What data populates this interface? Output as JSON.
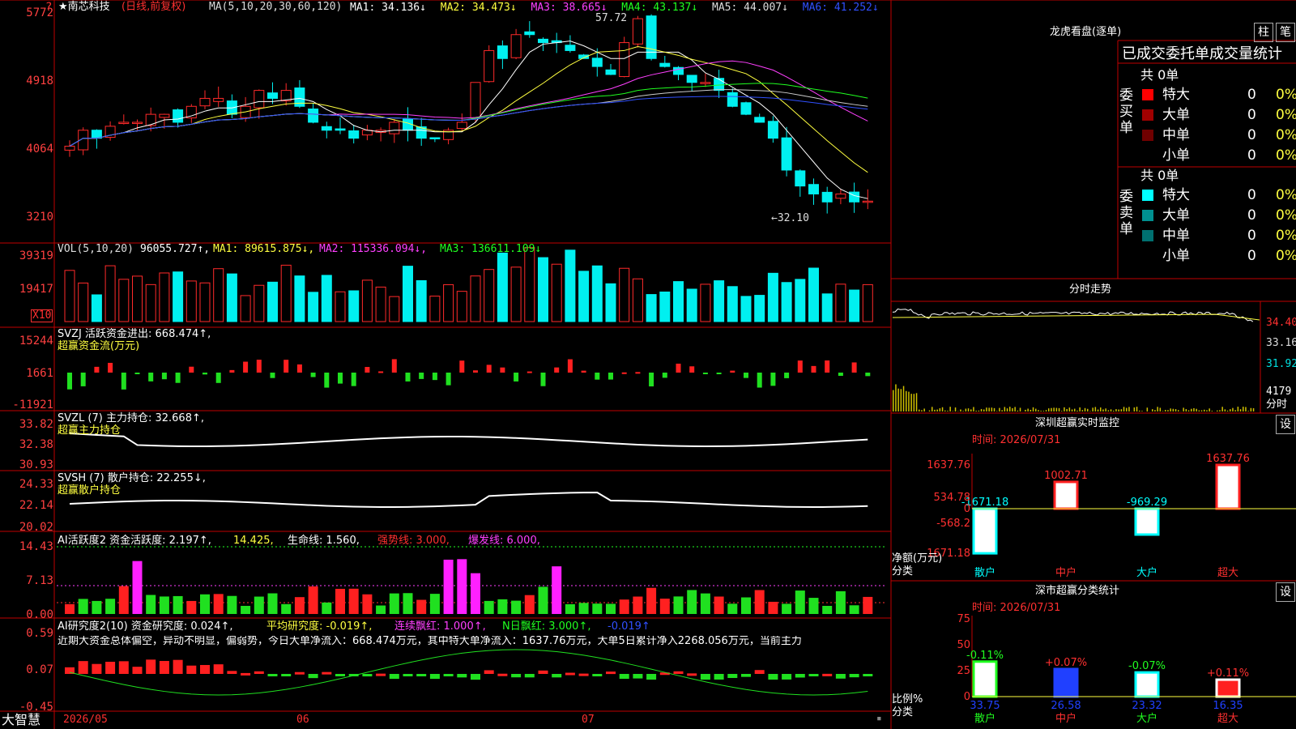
{
  "colors": {
    "up": "#ff2a2a",
    "down": "#00f0f0",
    "grid": "#c00000",
    "white": "#ffffff",
    "yellow": "#ffff40",
    "magenta": "#ff40ff",
    "green": "#20ff20",
    "blue": "#3040ff",
    "text": "#dddddd"
  },
  "main": {
    "menu_icon": "menu-icon",
    "stock": "★南芯科技",
    "mode": "(日线,前复权)",
    "ma_spec": "MA(5,10,20,30,60,120)",
    "ma": [
      {
        "label": "MA1: 34.136↓",
        "color": "#ffffff"
      },
      {
        "label": "MA2: 34.473↓",
        "color": "#ffff40"
      },
      {
        "label": "MA3: 38.665↓",
        "color": "#ff40ff"
      },
      {
        "label": "MA4: 43.137↓",
        "color": "#20ff20"
      },
      {
        "label": "MA5: 44.007↓",
        "color": "#dddddd"
      },
      {
        "label": "MA6: 41.252↓",
        "color": "#3050ff"
      }
    ],
    "axis": [
      "5772",
      "4918",
      "4064",
      "3210"
    ],
    "high_label": "57.72",
    "low_label": "←32.10"
  },
  "vol": {
    "title": "VOL(5,10,20)",
    "value": "96055.727↑,",
    "ma": [
      "MA1: 89615.875↓,",
      "MA2: 115336.094↓,",
      "MA3: 136611.109↓"
    ],
    "axis": [
      "39319",
      "19417"
    ],
    "unit": "X10"
  },
  "svzj": {
    "title": "SVZJ  活跃资金进出: 668.474↑,",
    "sub": "超赢资金流(万元)",
    "axis": [
      "15244",
      "1661",
      "-11921"
    ]
  },
  "svzl": {
    "title": "SVZL (7) 主力持仓: 32.668↑,",
    "sub": "超赢主力持仓",
    "axis": [
      "33.82",
      "32.38",
      "30.93"
    ]
  },
  "svsh": {
    "title": "SVSH (7) 散户持仓: 22.255↓,",
    "sub": "超赢散户持仓",
    "axis": [
      "24.33",
      "22.14",
      "20.02"
    ]
  },
  "ai1": {
    "title": "AI活跃度2 资金活跃度: 2.197↑,",
    "parts": [
      "14.425,",
      "生命线: 1.560,",
      "强势线: 3.000,",
      "爆发线: 6.000,"
    ],
    "axis": [
      "14.43",
      "7.13",
      "0.00"
    ]
  },
  "ai2": {
    "title": "AI研究度2(10) 资金研究度: 0.024↑,",
    "parts": [
      "平均研究度: -0.019↑,",
      "连续飘红: 1.000↑,",
      "N日飘红: 3.000↑,",
      "-0.019↑"
    ],
    "summary": "近期大资金总体偏空，异动不明显，偏弱势，今日大单净流入：668.474万元，其中特大单净流入：1637.76万元，大单5日累计净入2268.056万元，当前主力",
    "axis": [
      "0.59",
      "0.07",
      "-0.45"
    ]
  },
  "bottom": {
    "brand": "大智慧",
    "dates": [
      "2026/05",
      "06",
      "07"
    ]
  },
  "lhb": {
    "title": "龙虎看盘(逐单)",
    "btn1": "柱",
    "btn2": "笔",
    "header": "已成交委托单成交量统计",
    "buy_label": "委买单",
    "sell_label": "委卖单",
    "buy_total": "共 0单",
    "sell_total": "共 0单",
    "buy_rows": [
      {
        "name": "特大",
        "v": "0",
        "p": "0%",
        "c": "#ff0000"
      },
      {
        "name": "大单",
        "v": "0",
        "p": "0%",
        "c": "#a00000"
      },
      {
        "name": "中单",
        "v": "0",
        "p": "0%",
        "c": "#700000"
      },
      {
        "name": "小单",
        "v": "0",
        "p": "0%",
        "c": "#000000"
      }
    ],
    "sell_rows": [
      {
        "name": "特大",
        "v": "0",
        "p": "0%",
        "c": "#00ffff"
      },
      {
        "name": "大单",
        "v": "0",
        "p": "0%",
        "c": "#009090"
      },
      {
        "name": "中单",
        "v": "0",
        "p": "0%",
        "c": "#007070"
      },
      {
        "name": "小单",
        "v": "0",
        "p": "0%",
        "c": "#000000"
      }
    ]
  },
  "fenshi": {
    "title": "分时走势",
    "axis": [
      "34.40",
      "33.16",
      "31.92"
    ],
    "vol": "4179",
    "vol_label": "分时"
  },
  "sz_monitor": {
    "title": "深圳超赢实时监控",
    "btn": "设",
    "time": "时间: 2026/07/31",
    "axis": [
      "1637.76",
      "534.78",
      "0",
      "-568.2",
      "-1671.18"
    ],
    "y_label": "净额(万元)",
    "x_label": "分类",
    "chart_data": {
      "type": "bar",
      "categories": [
        "散户",
        "中户",
        "大户",
        "超大"
      ],
      "values": [
        -1671.18,
        1002.71,
        -969.29,
        1637.76
      ],
      "value_labels": [
        "-1671.18",
        "1002.71",
        "-969.29",
        "1637.76"
      ],
      "ylim": [
        -1671.18,
        1637.76
      ]
    }
  },
  "sz_stats": {
    "title": "深市超赢分类统计",
    "btn": "设",
    "time": "时间: 2026/07/31",
    "axis": [
      "75",
      "50",
      "25",
      "0"
    ],
    "y_label": "比例%",
    "x_label": "分类",
    "chart_data": {
      "type": "bar",
      "categories": [
        "散户",
        "中户",
        "大户",
        "超大"
      ],
      "values": [
        33.75,
        26.58,
        23.32,
        16.35
      ],
      "changes": [
        "-0.11%",
        "+0.07%",
        "-0.07%",
        "+0.11%"
      ],
      "value_labels": [
        "33.75",
        "26.58",
        "23.32",
        "16.35"
      ],
      "ylim": [
        0,
        75
      ]
    }
  }
}
